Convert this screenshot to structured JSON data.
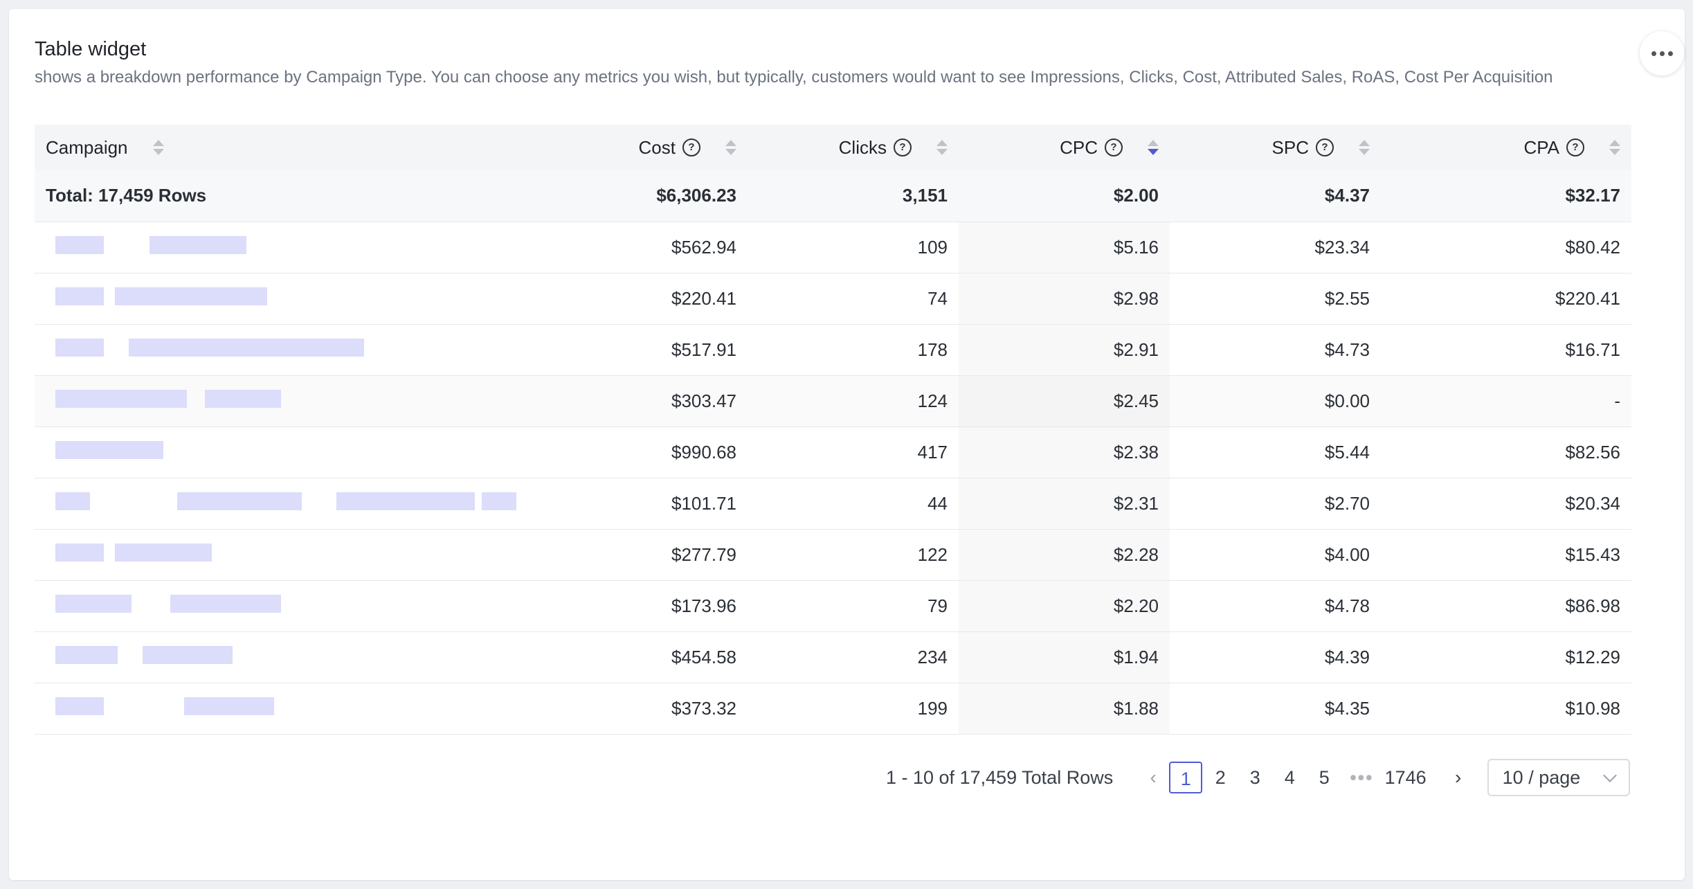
{
  "widget": {
    "title": "Table widget",
    "description": "shows a breakdown performance by Campaign Type. You can choose any metrics you wish, but typically, customers would want to see Impressions, Clicks, Cost, Attributed Sales, RoAS, Cost Per Acquisition",
    "more_icon": "more-horizontal-icon"
  },
  "table": {
    "columns": [
      "Campaign",
      "Cost",
      "Clicks",
      "CPC",
      "SPC",
      "CPA"
    ],
    "help_icon": "help-circle-icon",
    "sorted_column": "CPC",
    "sort_direction": "descending",
    "total": {
      "label": "Total: 17,459 Rows",
      "cost": "$6,306.23",
      "clicks": "3,151",
      "cpc": "$2.00",
      "spc": "$4.37",
      "cpa": "$32.17"
    },
    "rows": [
      {
        "cost": "$562.94",
        "clicks": "109",
        "cpc": "$5.16",
        "spc": "$23.34",
        "cpa": "$80.42"
      },
      {
        "cost": "$220.41",
        "clicks": "74",
        "cpc": "$2.98",
        "spc": "$2.55",
        "cpa": "$220.41"
      },
      {
        "cost": "$517.91",
        "clicks": "178",
        "cpc": "$2.91",
        "spc": "$4.73",
        "cpa": "$16.71"
      },
      {
        "cost": "$303.47",
        "clicks": "124",
        "cpc": "$2.45",
        "spc": "$0.00",
        "cpa": "-"
      },
      {
        "cost": "$990.68",
        "clicks": "417",
        "cpc": "$2.38",
        "spc": "$5.44",
        "cpa": "$82.56"
      },
      {
        "cost": "$101.71",
        "clicks": "44",
        "cpc": "$2.31",
        "spc": "$2.70",
        "cpa": "$20.34"
      },
      {
        "cost": "$277.79",
        "clicks": "122",
        "cpc": "$2.28",
        "spc": "$4.00",
        "cpa": "$15.43"
      },
      {
        "cost": "$173.96",
        "clicks": "79",
        "cpc": "$2.20",
        "spc": "$4.78",
        "cpa": "$86.98"
      },
      {
        "cost": "$454.58",
        "clicks": "234",
        "cpc": "$1.94",
        "spc": "$4.39",
        "cpa": "$12.29"
      },
      {
        "cost": "$373.32",
        "clicks": "199",
        "cpc": "$1.88",
        "spc": "$4.35",
        "cpa": "$10.98"
      }
    ]
  },
  "pagination": {
    "summary": "1 - 10 of 17,459 Total Rows",
    "prev_icon": "chevron-left-icon",
    "next_icon": "chevron-right-icon",
    "pages": [
      "1",
      "2",
      "3",
      "4",
      "5"
    ],
    "current_page": "1",
    "ellipsis": "•••",
    "last_page": "1746",
    "page_size": "10 / page",
    "page_size_icon": "chevron-down-icon"
  },
  "colors": {
    "accent": "#4f5bd5",
    "blurred_text": "#dcdcfb",
    "header_bg": "#f4f5f7"
  }
}
